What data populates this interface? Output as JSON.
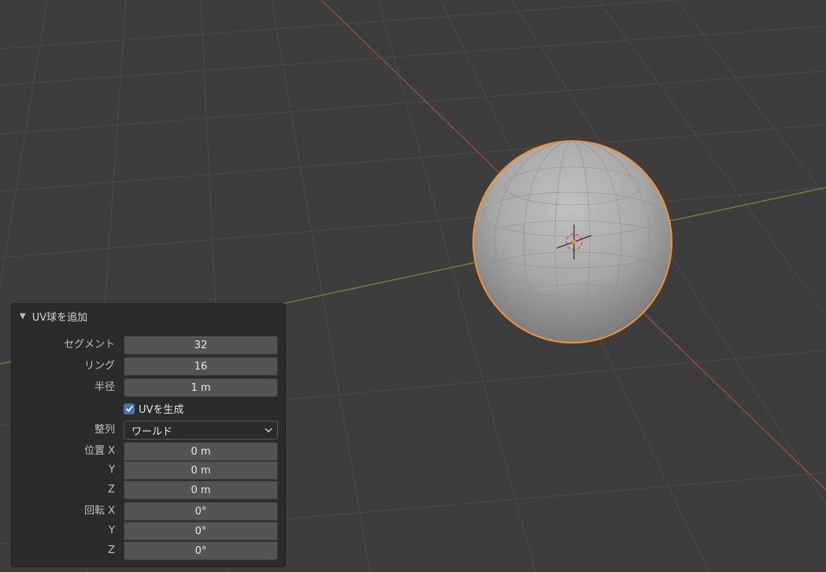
{
  "panel": {
    "title": "UV球を追加",
    "fields": {
      "segments": {
        "label": "セグメント",
        "value": "32"
      },
      "rings": {
        "label": "リング",
        "value": "16"
      },
      "radius": {
        "label": "半径",
        "value": "1 m"
      },
      "generate_uvs": {
        "label": "UVを生成",
        "checked": true
      },
      "align": {
        "label": "整列",
        "value": "ワールド"
      },
      "location": {
        "label": "位置",
        "x_label": "X",
        "y_label": "Y",
        "z_label": "Z",
        "x": "0 m",
        "y": "0 m",
        "z": "0 m"
      },
      "rotation": {
        "label": "回転",
        "x_label": "X",
        "y_label": "Y",
        "z_label": "Z",
        "x": "0°",
        "y": "0°",
        "z": "0°"
      }
    }
  },
  "icons": [
    "disclosure-triangle-icon",
    "checkmark-icon",
    "chevron-down-icon",
    "origin-cursor-icon"
  ],
  "colors": {
    "background": "#3d3d3d",
    "grid": "#4d4d4d",
    "x_axis": "#9b4b4b",
    "y_axis": "#6f8b2f",
    "selection_outline": "#f2922e",
    "panel_bg": "#2b2b2b",
    "field_bg": "#545454",
    "checkbox": "#4772b3"
  }
}
